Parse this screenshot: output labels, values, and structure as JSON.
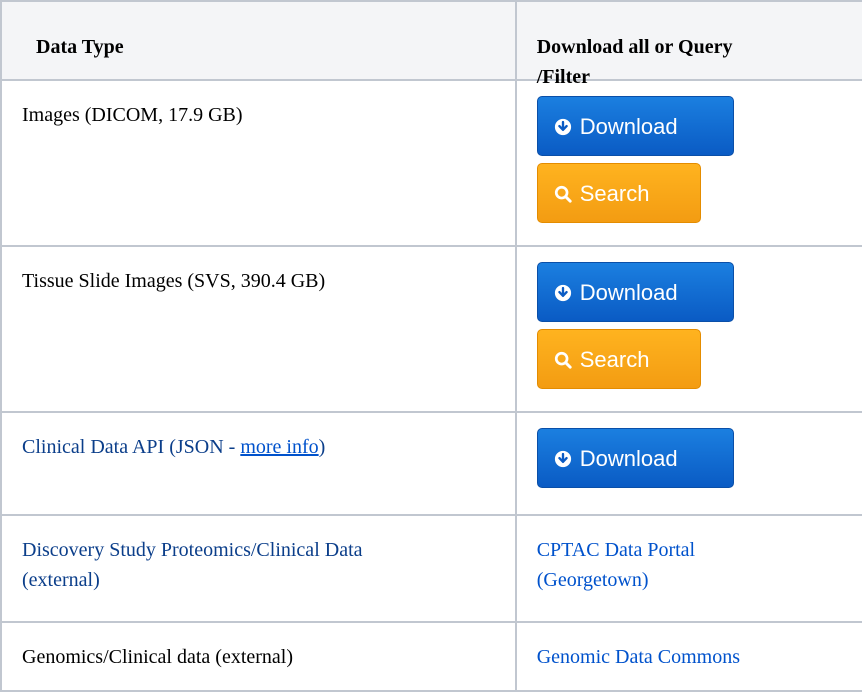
{
  "table": {
    "headers": {
      "data_type": "Data Type",
      "download_line1": "Download all or Query",
      "download_line2": "/Filter"
    },
    "rows": [
      {
        "label": "Images (DICOM, 17.9 GB)",
        "download_label": "Download",
        "search_label": "Search"
      },
      {
        "label": "Tissue Slide Images (SVS, 390.4 GB)",
        "download_label": "Download",
        "search_label": "Search"
      },
      {
        "label_prefix": "Clinical Data API (JSON - ",
        "label_link": "more info",
        "label_suffix": ")",
        "download_label": "Download"
      },
      {
        "label_line1": "Discovery Study Proteomics/Clinical Data",
        "label_line2": "(external)",
        "link_line1": "CPTAC Data Portal",
        "link_line2": "(Georgetown)"
      },
      {
        "label": "Genomics/Clinical data (external)",
        "link": "Genomic Data Commons"
      }
    ]
  },
  "colors": {
    "download_button": "#0a5bc4",
    "search_button": "#f39c12",
    "link": "#0052cc",
    "header_bg": "#f4f5f7",
    "border": "#c1c7d0"
  },
  "icons": {
    "download": "arrow-down-circle-icon",
    "search": "magnifier-icon"
  }
}
